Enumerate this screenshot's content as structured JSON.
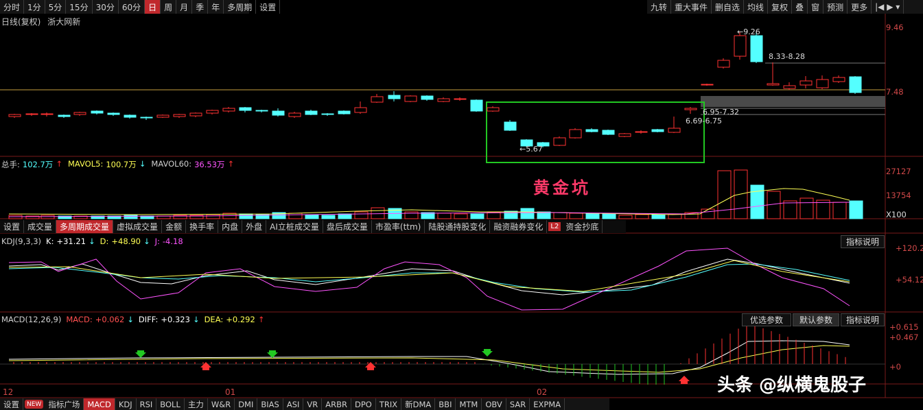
{
  "top_toolbar": {
    "periods": [
      "分时",
      "1分",
      "5分",
      "15分",
      "30分",
      "60分",
      "日",
      "周",
      "月",
      "季",
      "年",
      "多周期",
      "设置"
    ],
    "active": "日",
    "right": [
      "九转",
      "重大事件",
      "删自选",
      "均线",
      "复权",
      "叠",
      "窗",
      "预测",
      "更多"
    ]
  },
  "price_panel": {
    "title": "日线(复权)",
    "stock": "浙大网新",
    "axis": [
      "9.46",
      "7.48"
    ],
    "annotations": {
      "high": "9.26",
      "range1": "8.33-8.28",
      "range2": "6.95-7.32",
      "range3": "6.69-6.75",
      "low": "5.67"
    }
  },
  "volume_panel": {
    "total_label": "总手: ",
    "total_value": "102.7万",
    "mavol5_label": "MAVOL5: ",
    "mavol5_value": "100.7万",
    "mavol60_label": "MAVOL60: ",
    "mavol60_value": "36.53万",
    "axis": [
      "27127",
      "13754"
    ],
    "unit": "X100",
    "annotation": "黄金坑",
    "tabs": [
      "设置",
      "成交量",
      "多周期成交量",
      "虚拟成交量",
      "金额",
      "换手率",
      "内盘",
      "外盘",
      "AI立桩成交量",
      "盘后成交量",
      "市盈率(ttm)",
      "陆股通持股变化",
      "融资融券变化",
      "资金抄底"
    ],
    "active_tab": "多周期成交量",
    "badge": "L2"
  },
  "kdj_panel": {
    "name": "KDJ(9,3,3)",
    "k_label": "K: ",
    "k_value": "+31.21",
    "d_label": "D: ",
    "d_value": "+48.90",
    "j_label": "J: ",
    "j_value": "-4.18",
    "axis": [
      "+120.2",
      "+54.12"
    ],
    "explain": "指标说明"
  },
  "macd_panel": {
    "name": "MACD(12,26,9)",
    "macd_label": "MACD: ",
    "macd_value": "+0.062",
    "diff_label": "DIFF: ",
    "diff_value": "+0.323",
    "dea_label": "DEA: ",
    "dea_value": "+0.292",
    "axis": [
      "+0.615",
      "+0.467",
      "+0"
    ],
    "buttons": [
      "优选参数",
      "默认参数",
      "指标说明"
    ]
  },
  "dates": [
    "12",
    "01",
    "02"
  ],
  "bottom_toolbar": {
    "items": [
      "设置",
      "指标广场",
      "MACD",
      "KDJ",
      "RSI",
      "BOLL",
      "主力",
      "W&R",
      "DMI",
      "BIAS",
      "ASI",
      "VR",
      "ARBR",
      "DPO",
      "TRIX",
      "新DMA",
      "BBI",
      "MTM",
      "OBV",
      "SAR",
      "EXPMA"
    ],
    "active": "MACD",
    "badge": "NEW"
  },
  "watermark": "头条 @纵横鬼股子",
  "colors": {
    "up": "#ff3232",
    "down": "#54ffff",
    "ma5": "#ffffff",
    "ma10": "#ffff00",
    "k": "#ffffff",
    "d": "#ffff54",
    "j": "#ff54ff"
  }
}
